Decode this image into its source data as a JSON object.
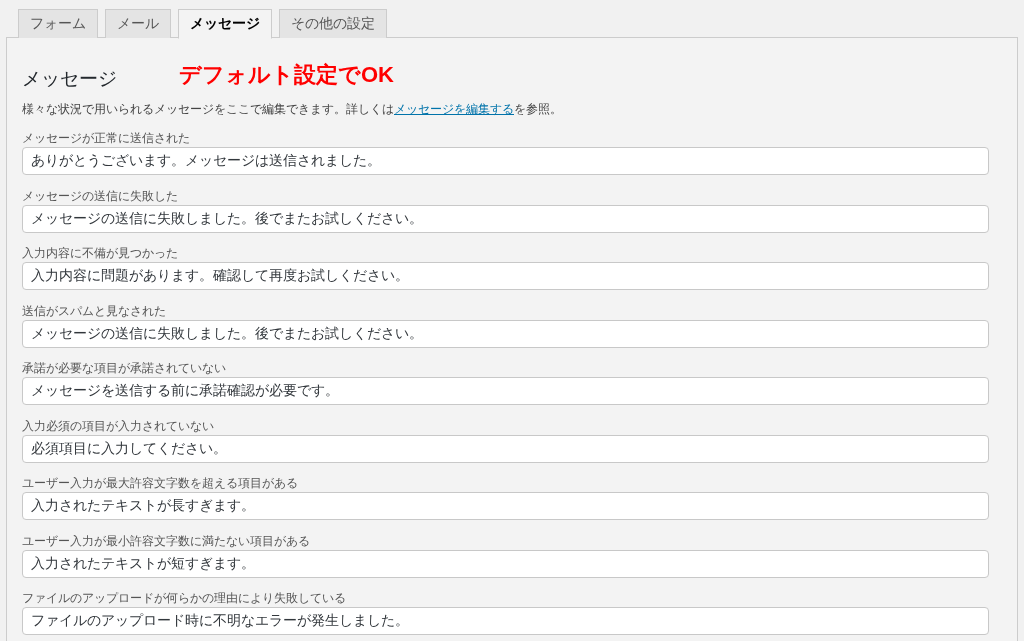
{
  "tabs": [
    {
      "label": "フォーム",
      "selected": false
    },
    {
      "label": "メール",
      "selected": false
    },
    {
      "label": "メッセージ",
      "selected": true
    },
    {
      "label": "その他の設定",
      "selected": false
    }
  ],
  "panel": {
    "title": "メッセージ",
    "annotation": "デフォルト設定でOK",
    "description": {
      "before": "様々な状況で用いられるメッセージをここで編集できます。詳しくは",
      "link": "メッセージを編集する",
      "after": "を参照。"
    },
    "fields": [
      {
        "label": "メッセージが正常に送信された",
        "value": "ありがとうございます。メッセージは送信されました。"
      },
      {
        "label": "メッセージの送信に失敗した",
        "value": "メッセージの送信に失敗しました。後でまたお試しください。"
      },
      {
        "label": "入力内容に不備が見つかった",
        "value": "入力内容に問題があります。確認して再度お試しください。"
      },
      {
        "label": "送信がスパムと見なされた",
        "value": "メッセージの送信に失敗しました。後でまたお試しください。"
      },
      {
        "label": "承諾が必要な項目が承諾されていない",
        "value": "メッセージを送信する前に承諾確認が必要です。"
      },
      {
        "label": "入力必須の項目が入力されていない",
        "value": "必須項目に入力してください。"
      },
      {
        "label": "ユーザー入力が最大許容文字数を超える項目がある",
        "value": "入力されたテキストが長すぎます。"
      },
      {
        "label": "ユーザー入力が最小許容文字数に満たない項目がある",
        "value": "入力されたテキストが短すぎます。"
      },
      {
        "label": "ファイルのアップロードが何らかの理由により失敗している",
        "value": "ファイルのアップロード時に不明なエラーが発生しました。"
      }
    ]
  }
}
